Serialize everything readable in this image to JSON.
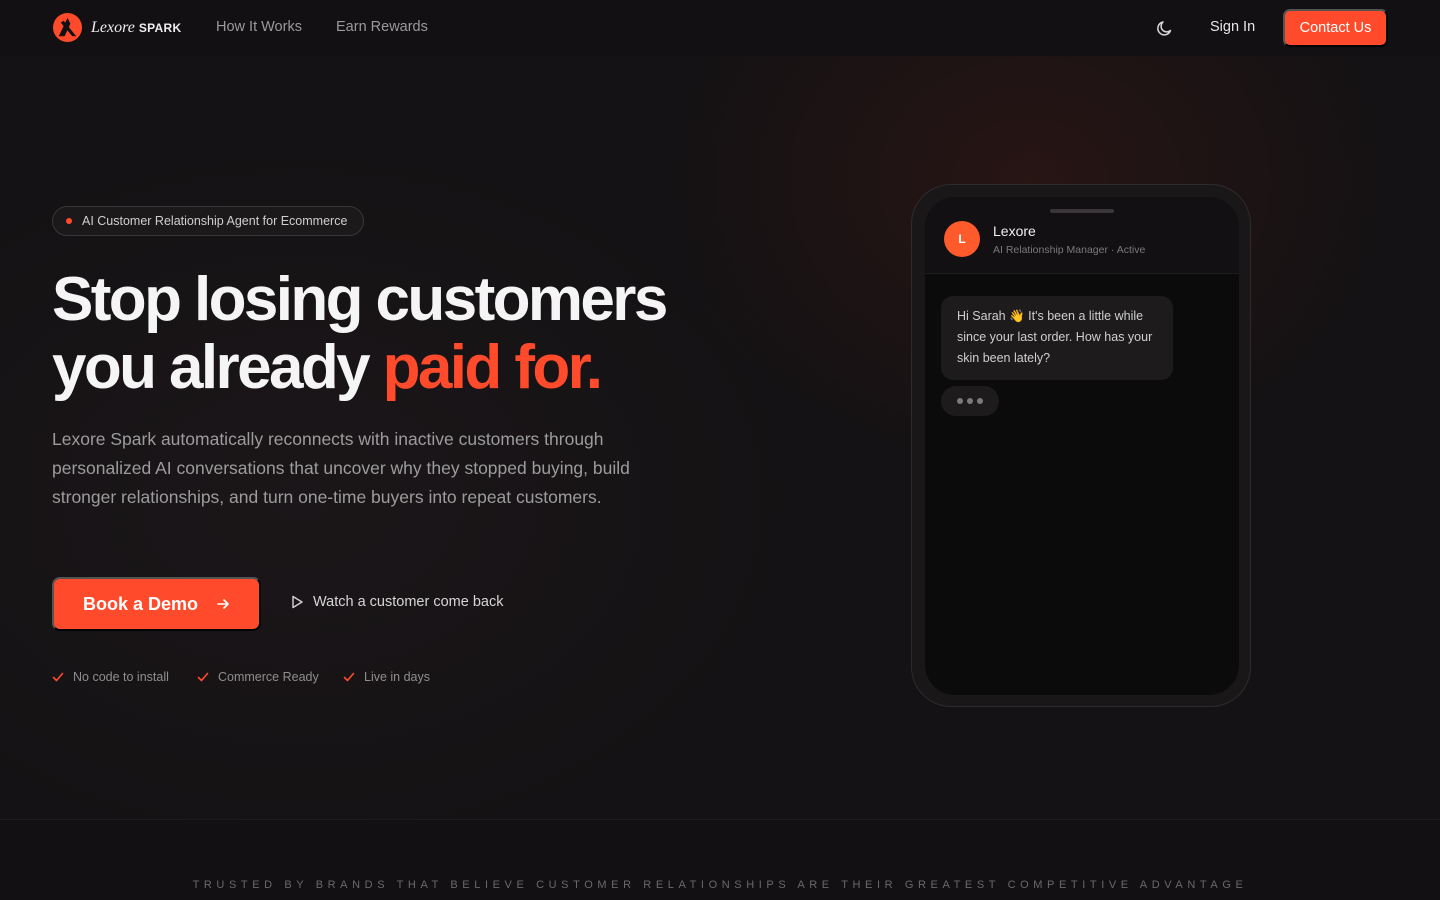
{
  "nav": {
    "brand_name": "Lexore",
    "brand_suffix": "SPARK",
    "links": [
      "How It Works",
      "Earn Rewards"
    ],
    "theme_icon": "moon-icon",
    "signin_label": "Sign In",
    "contact_label": "Contact Us"
  },
  "hero": {
    "badge": "AI Customer Relationship Agent for Ecommerce",
    "headline_line1": "Stop losing customers",
    "headline_line2_start": "you already ",
    "headline_accent": "paid for.",
    "subtext": "Lexore Spark automatically reconnects with inactive customers through personalized AI conversations that uncover why they stopped buying, build stronger relationships, and turn one-time buyers into repeat customers.",
    "cta_primary": "Book a Demo",
    "cta_secondary": "Watch a customer come back",
    "features": [
      "No code to install",
      "Commerce Ready",
      "Live in days"
    ]
  },
  "phone": {
    "avatar_letter": "L",
    "contact_name": "Lexore",
    "contact_status": "AI Relationship Manager · Active",
    "message": "Hi Sarah 👋 It's been a little while since your last order. How has your skin been lately?"
  },
  "trusted_text": "TRUSTED BY BRANDS THAT BELIEVE CUSTOMER RELATIONSHIPS ARE THEIR GREATEST COMPETITIVE ADVANTAGE",
  "colors": {
    "accent": "#ff4b2b",
    "background": "#141214"
  }
}
